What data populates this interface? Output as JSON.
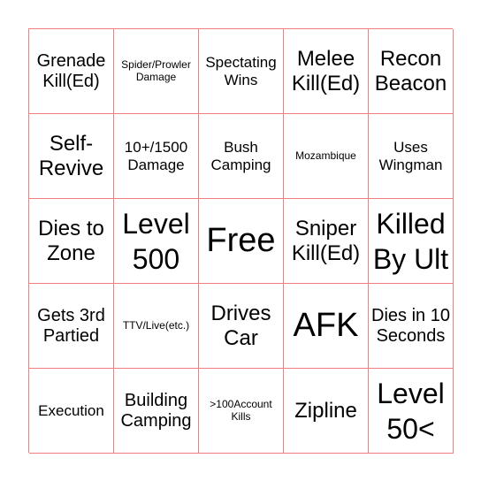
{
  "board": {
    "cells": [
      {
        "text": "Grenade Kill(Ed)",
        "size": "s3"
      },
      {
        "text": "Spider/Prowler Damage",
        "size": "s1"
      },
      {
        "text": "Spectating Wins",
        "size": "s2"
      },
      {
        "text": "Melee Kill(Ed)",
        "size": "s4"
      },
      {
        "text": "Recon Beacon",
        "size": "s4"
      },
      {
        "text": "Self-Revive",
        "size": "s4"
      },
      {
        "text": "10+/1500 Damage",
        "size": "s2"
      },
      {
        "text": "Bush Camping",
        "size": "s2"
      },
      {
        "text": "Mozambique",
        "size": "s1"
      },
      {
        "text": "Uses Wingman",
        "size": "s2"
      },
      {
        "text": "Dies to Zone",
        "size": "s4"
      },
      {
        "text": "Level 500",
        "size": "s5"
      },
      {
        "text": "Free",
        "size": "s6"
      },
      {
        "text": "Sniper Kill(Ed)",
        "size": "s4"
      },
      {
        "text": "Killed By Ult",
        "size": "s5"
      },
      {
        "text": "Gets 3rd Partied",
        "size": "s3"
      },
      {
        "text": "TTV/Live(etc.)",
        "size": "s1"
      },
      {
        "text": "Drives Car",
        "size": "s4"
      },
      {
        "text": "AFK",
        "size": "s6"
      },
      {
        "text": "Dies in 10 Seconds",
        "size": "s3"
      },
      {
        "text": "Execution",
        "size": "s2"
      },
      {
        "text": "Building Camping",
        "size": "s3"
      },
      {
        "text": ">100Account Kills",
        "size": "s1"
      },
      {
        "text": "Zipline",
        "size": "s4"
      },
      {
        "text": "Level 50<",
        "size": "s5"
      }
    ]
  }
}
